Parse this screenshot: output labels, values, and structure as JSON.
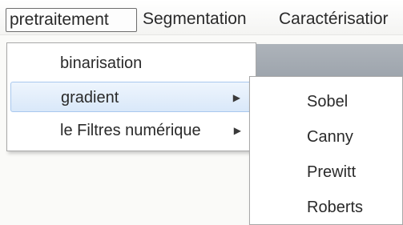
{
  "menubar": {
    "items": [
      {
        "label": "pretraitement",
        "active": true
      },
      {
        "label": "Segmentation",
        "active": false
      },
      {
        "label": "Caractérisatior",
        "active": false
      }
    ]
  },
  "dropdown": {
    "items": [
      {
        "label": "binarisation",
        "has_submenu": false
      },
      {
        "label": "gradient",
        "has_submenu": true,
        "highlighted": true
      },
      {
        "label": "le Filtres numérique",
        "has_submenu": true
      }
    ],
    "submenu_arrow": "▶"
  },
  "submenu": {
    "parent": "gradient",
    "items": [
      {
        "label": "Sobel"
      },
      {
        "label": "Canny"
      },
      {
        "label": "Prewitt"
      },
      {
        "label": "Roberts"
      }
    ]
  },
  "colors": {
    "highlight_bg": "#dce9f9",
    "highlight_border": "#a9c8ee",
    "menu_border": "#a8a8a8",
    "active_border": "#6e6e6e"
  },
  "icons": {
    "submenu_arrow": "submenu-arrow-icon"
  }
}
